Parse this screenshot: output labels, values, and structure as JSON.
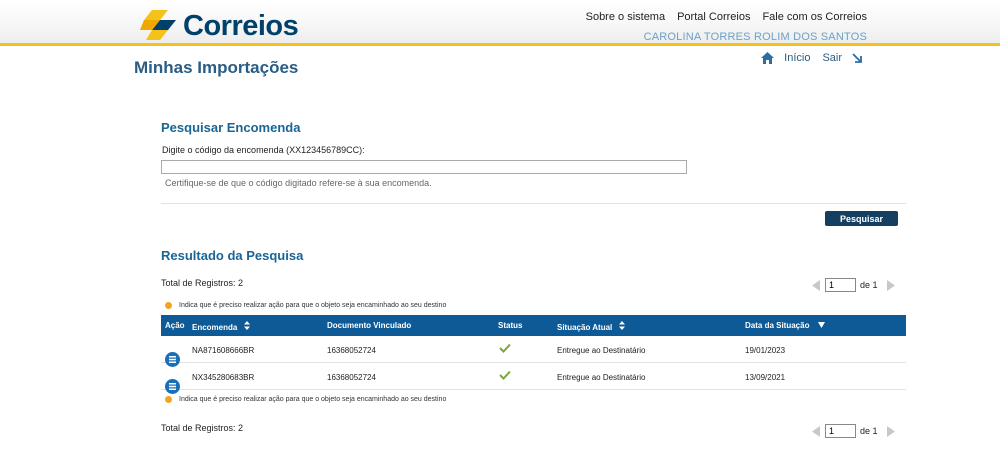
{
  "header": {
    "logo_text": "Correios",
    "nav": [
      "Sobre o sistema",
      "Portal Correios",
      "Fale com os Correios"
    ],
    "user_name": "CAROLINA TORRES ROLIM DOS SANTOS"
  },
  "page": {
    "title": "Minhas Importações",
    "home_label": "Início",
    "exit_label": "Sair"
  },
  "search": {
    "title": "Pesquisar Encomenda",
    "label": "Digite o código da encomenda (XX123456789CC):",
    "value": "",
    "hint": "Certifique-se de que o código digitado refere-se à sua encomenda.",
    "button": "Pesquisar"
  },
  "results": {
    "title": "Resultado da Pesquisa",
    "total_top": "Total de Registros: 2",
    "total_bottom": "Total de Registros: 2",
    "legend": "Indica que é preciso realizar ação para que o objeto seja encaminhado ao seu destino",
    "pager": {
      "page": "1",
      "of_label": "de 1"
    },
    "columns": {
      "action": "Ação",
      "parcel": "Encomenda",
      "document": "Documento Vinculado",
      "status": "Status",
      "situation": "Situação Atual",
      "date": "Data da Situação"
    },
    "rows": [
      {
        "parcel": "NA871608666BR",
        "document": "16368052724",
        "situation": "Entregue ao Destinatário",
        "date": "19/01/2023"
      },
      {
        "parcel": "NX345280683BR",
        "document": "16368052724",
        "situation": "Entregue ao Destinatário",
        "date": "13/09/2021"
      }
    ]
  },
  "colors": {
    "brand_blue": "#00416b",
    "accent_yellow": "#f5c21b",
    "table_header": "#0e5a96",
    "button": "#153f61",
    "status_ok": "#7aa83a",
    "alert_orange": "#f4a51a"
  },
  "icons": [
    "correios-logo-icon",
    "home-icon",
    "exit-arrow-icon",
    "sort-icon",
    "sort-down-icon",
    "list-icon",
    "check-icon",
    "prev-page-icon",
    "next-page-icon",
    "orange-dot-icon"
  ]
}
